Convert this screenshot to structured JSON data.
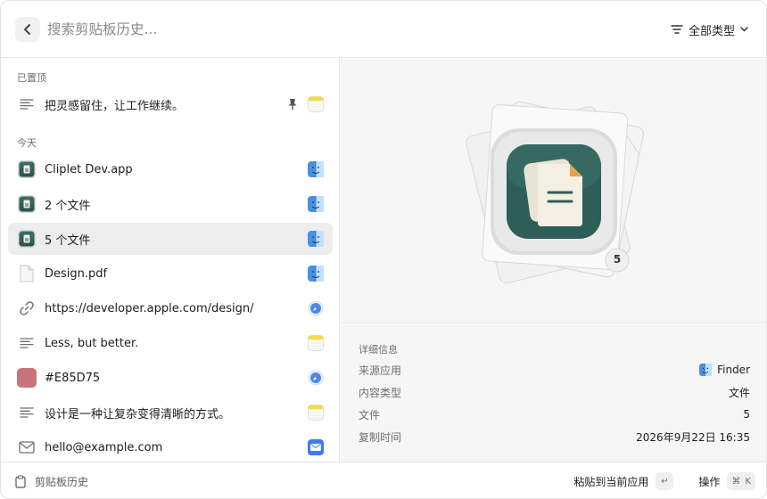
{
  "header": {
    "search_placeholder": "搜索剪贴板历史...",
    "filter_label": "全部类型"
  },
  "list": {
    "pinned_title": "已置顶",
    "today_title": "今天",
    "pinned_items": [
      {
        "label": "把灵感留住，让工作继续。",
        "type_icon": "text-lines-icon",
        "source_icon": "notes-app-icon",
        "pinned": true
      }
    ],
    "today_items": [
      {
        "label": "Cliplet Dev.app",
        "type_icon": "cliplet-app-icon",
        "source_icon": "finder-app-icon"
      },
      {
        "label": "2 个文件",
        "type_icon": "cliplet-app-icon",
        "source_icon": "finder-app-icon"
      },
      {
        "label": "5 个文件",
        "type_icon": "cliplet-app-icon",
        "source_icon": "finder-app-icon",
        "selected": true
      },
      {
        "label": "Design.pdf",
        "type_icon": "document-icon",
        "source_icon": "finder-app-icon"
      },
      {
        "label": "https://developer.apple.com/design/",
        "type_icon": "link-icon",
        "source_icon": "safari-app-icon"
      },
      {
        "label": "Less, but better.",
        "type_icon": "text-lines-icon",
        "source_icon": "notes-app-icon"
      },
      {
        "label": "#E85D75",
        "type_icon": "color-swatch",
        "swatch_color": "#C9737D",
        "source_icon": "safari-app-icon"
      },
      {
        "label": "设计是一种让复杂变得清晰的方式。",
        "type_icon": "text-lines-icon",
        "source_icon": "notes-app-icon"
      },
      {
        "label": "hello@example.com",
        "type_icon": "envelope-icon",
        "source_icon": "mail-app-icon"
      }
    ]
  },
  "preview": {
    "badge_count": "5"
  },
  "details": {
    "title": "详细信息",
    "rows": [
      {
        "key": "来源应用",
        "value": "Finder",
        "icon": "finder-app-icon"
      },
      {
        "key": "内容类型",
        "value": "文件"
      },
      {
        "key": "文件",
        "value": "5"
      },
      {
        "key": "复制时间",
        "value": "2026年9月22日 16:35"
      }
    ]
  },
  "footer": {
    "history_label": "剪贴板历史",
    "paste_label": "粘贴到当前应用",
    "paste_key": "↵",
    "actions_label": "操作",
    "actions_key_mod": "⌘",
    "actions_key": "K"
  },
  "colors": {
    "accent_teal": "#2F5E58",
    "selected_row": "#EDEDED",
    "finder_blue": "#4A90E2",
    "notes_yellow": "#F5D94E"
  }
}
